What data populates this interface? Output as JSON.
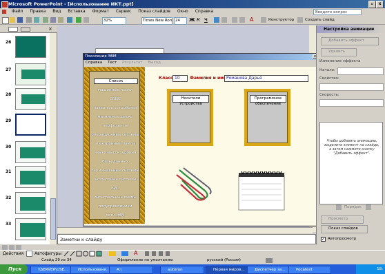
{
  "app": {
    "title": "Microsoft PowerPoint - [Использование ИКТ.ppt]"
  },
  "menubar": {
    "items": [
      "Файл",
      "Правка",
      "Вид",
      "Вставка",
      "Формат",
      "Сервис",
      "Показ слайдов",
      "Окно",
      "Справка"
    ],
    "ask_placeholder": "Введите вопрос"
  },
  "toolbar": {
    "zoom": "32%",
    "font": "Times New Roman",
    "font_size": "24",
    "designer": "Конструктор",
    "create_slide": "Создать слайд"
  },
  "thumbnails": {
    "numbers": [
      "26",
      "27",
      "28",
      "29",
      "30",
      "31",
      "32",
      "33"
    ],
    "selected": "29"
  },
  "dialog": {
    "title": "Поколения ЭВМ",
    "menu": [
      "Справка",
      "Тест",
      "Результат",
      "Выход"
    ],
    "list_items": [
      "Список",
      "машинные языки",
      "СБИС",
      "лазерные устройства",
      "магнитные диски",
      "перфоленты",
      "операционные системы",
      "электронные лампы",
      "языки высок. уровня",
      "базы данных",
      "терминальные системы",
      "экспертные системы",
      "БИС",
      "интегральные схемы",
      "полупроводники",
      "сети ЭВМ"
    ],
    "class_label": "Класс",
    "class_value": "10",
    "name_label": "Фамилия и имя",
    "name_value": "Романова Дарья",
    "panel_left": "Носители Устройства",
    "panel_right": "Программное обеспечение"
  },
  "notes": {
    "placeholder": "Заметки к слайду"
  },
  "taskpane": {
    "title": "Настройка анимации",
    "add_effect": "Добавить эффект",
    "remove": "Удалить",
    "change_effect": "Изменение эффекта",
    "start": "Начало:",
    "property": "Свойство:",
    "speed": "Скорость:",
    "hint": "Чтобы добавить анимацию, выделите элемент на слайде, а затем нажмите кнопку \"Добавить эффект\".",
    "order": "Порядок",
    "view": "Просмотр",
    "slideshow": "Показ слайдов",
    "autopreview": "Автопросмотр"
  },
  "drawbar": {
    "actions": "Действия",
    "autoshapes": "Автофигуры"
  },
  "status": {
    "slide": "Слайд 29 из 34",
    "design": "Оформление по умолчанию",
    "lang": "русский (Россия)"
  },
  "taskbar": {
    "start": "Пуск",
    "tasks": [
      "\\\\SERVER\\USE...",
      "Использовани...",
      "A:\\",
      "autorun",
      "Первая миров...",
      "Диспетчер за...",
      "Pocatext"
    ],
    "clock": "18:"
  }
}
